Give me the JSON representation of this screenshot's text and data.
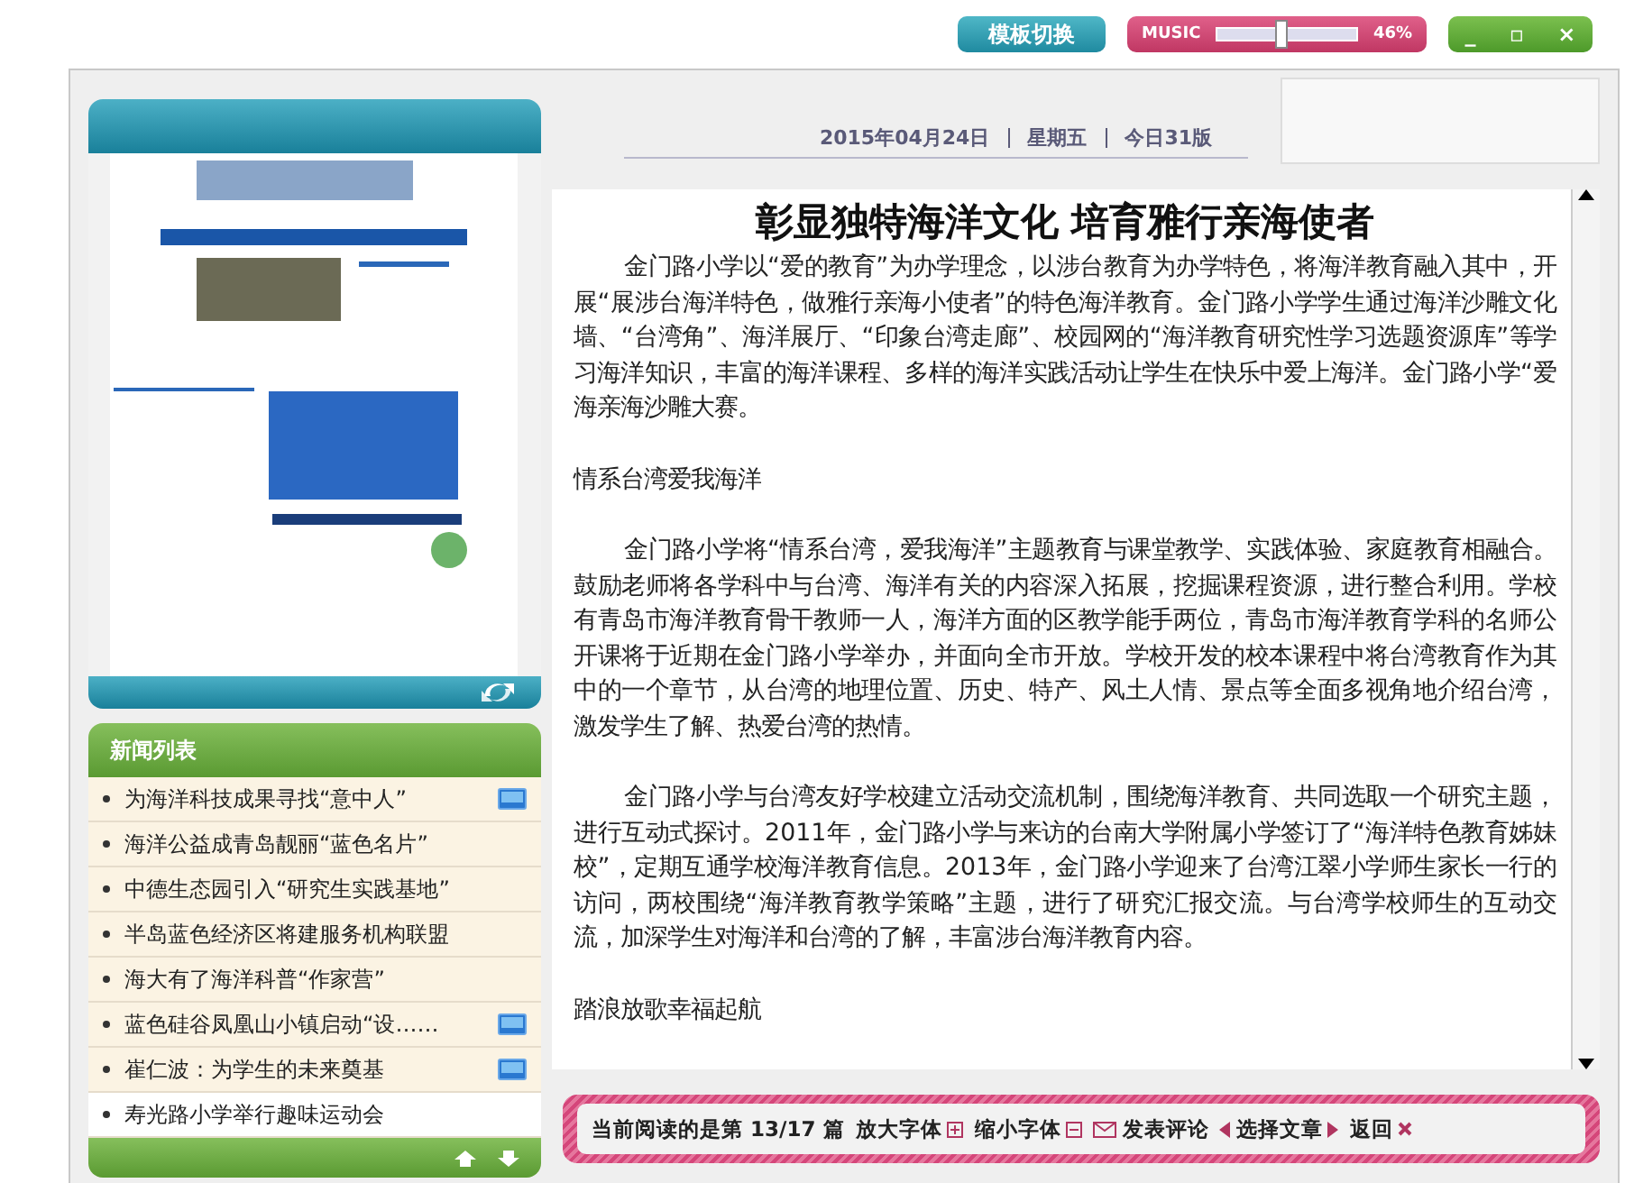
{
  "top_bar": {
    "template_button": "模板切换",
    "music": {
      "label": "MUSIC",
      "level": 0.46,
      "reading": "46%"
    },
    "window_buttons": [
      "_",
      "▫",
      "×"
    ]
  },
  "news_list": {
    "title": "新闻列表",
    "items": [
      {
        "title": "为海洋科技成果寻找“意中人”",
        "media_icon": true
      },
      {
        "title": "海洋公益成青岛靓丽“蓝色名片”",
        "media_icon": false
      },
      {
        "title": "中德生态园引入“研究生实践基地”",
        "media_icon": false
      },
      {
        "title": "半岛蓝色经济区将建服务机构联盟",
        "media_icon": false
      },
      {
        "title": "海大有了海洋科普“作家营”",
        "media_icon": false
      },
      {
        "title": "蓝色硅谷凤凰山小镇启动“设……",
        "media_icon": true
      },
      {
        "title": "崔仁波：为学生的未来奠基",
        "media_icon": true
      },
      {
        "title": "寿光路小学举行趣味运动会",
        "media_icon": false
      }
    ]
  },
  "date_bar": {
    "date": "2015年04月24日",
    "weekday": "星期五",
    "pages": "今日31版"
  },
  "article": {
    "title": "彰显独特海洋文化  培育雅行亲海使者",
    "blocks": [
      {
        "kind": "paragraph",
        "text": "金门路小学以“爱的教育”为办学理念，以涉台教育为办学特色，将海洋教育融入其中，开展“展涉台海洋特色，做雅行亲海小使者”的特色海洋教育。金门路小学学生通过海洋沙雕文化墙、“台湾角”、海洋展厅、“印象台湾走廊”、校园网的“海洋教育研究性学习选题资源库”等学习海洋知识，丰富的海洋课程、多样的海洋实践活动让学生在快乐中爱上海洋。金门路小学“爱海亲海沙雕大赛。"
      },
      {
        "kind": "subheading",
        "text": "情系台湾爱我海洋"
      },
      {
        "kind": "paragraph",
        "text": "金门路小学将“情系台湾，爱我海洋”主题教育与课堂教学、实践体验、家庭教育相融合。鼓励老师将各学科中与台湾、海洋有关的内容深入拓展，挖掘课程资源，进行整合利用。学校有青岛市海洋教育骨干教师一人，海洋方面的区教学能手两位，青岛市海洋教育学科的名师公开课将于近期在金门路小学举办，并面向全市开放。学校开发的校本课程中将台湾教育作为其中的一个章节，从台湾的地理位置、历史、特产、风土人情、景点等全面多视角地介绍台湾，激发学生了解、热爱台湾的热情。"
      },
      {
        "kind": "paragraph",
        "text": "金门路小学与台湾友好学校建立活动交流机制，围绕海洋教育、共同选取一个研究主题，进行互动式探讨。2011年，金门路小学与来访的台南大学附属小学签订了“海洋特色教育姊妹校”，定期互通学校海洋教育信息。2013年，金门路小学迎来了台湾江翠小学师生家长一行的访问，两校围绕“海洋教育教学策略”主题，进行了研究汇报交流。与台湾学校师生的互动交流，加深学生对海洋和台湾的了解，丰富涉台海洋教育内容。"
      },
      {
        "kind": "subheading",
        "text": "踏浪放歌幸福起航"
      }
    ]
  },
  "reader_bar": {
    "prefix": "当前阅读的是第",
    "position": "13/17",
    "suffix": "篇",
    "actions": [
      {
        "kind": "zoom_in",
        "label": "放大字体"
      },
      {
        "kind": "zoom_out",
        "label": "缩小字体"
      },
      {
        "kind": "comment",
        "label": "发表评论"
      },
      {
        "kind": "select",
        "label": "选择文章"
      },
      {
        "kind": "back",
        "label": "返回"
      }
    ]
  }
}
